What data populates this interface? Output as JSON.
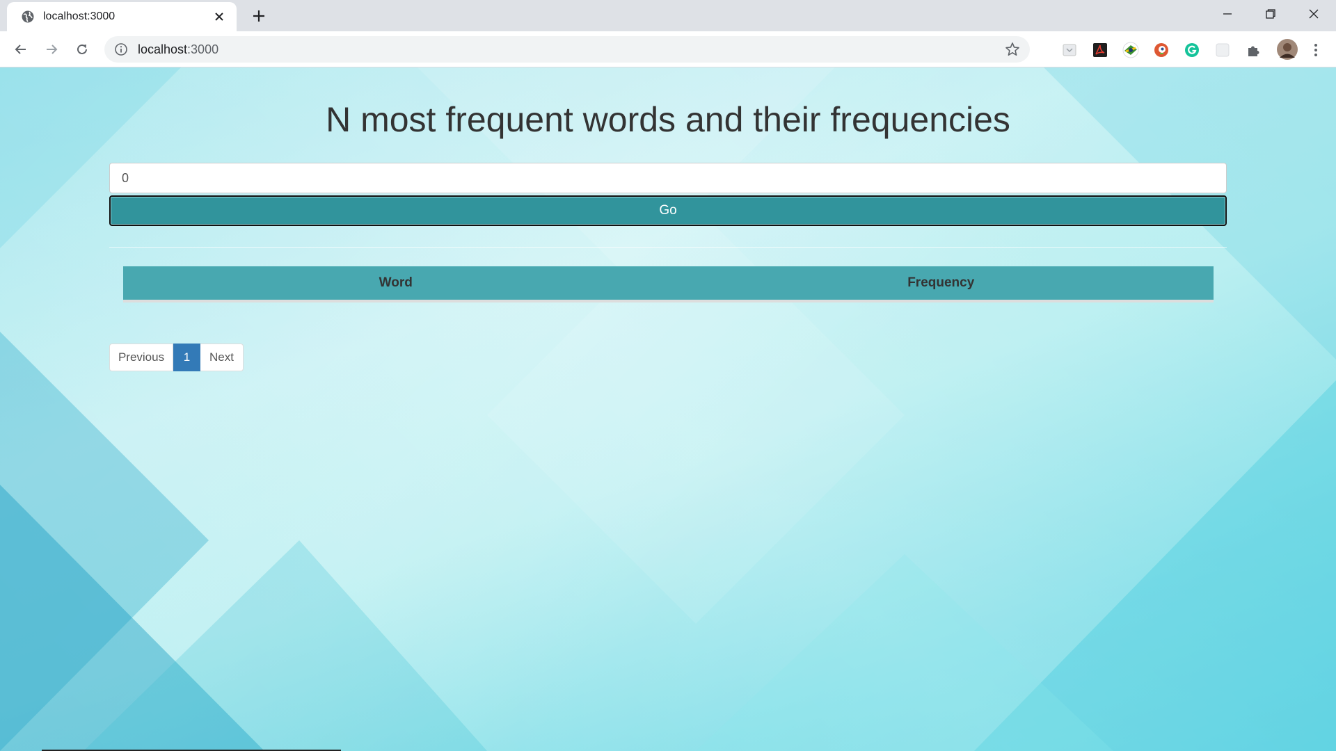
{
  "browser": {
    "tab_title": "localhost:3000",
    "url_host": "localhost",
    "url_rest": ":3000"
  },
  "icons": {
    "favicon": "globe-icon",
    "tab_close": "close-icon",
    "new_tab": "plus-icon",
    "minimize": "minimize-icon",
    "maximize": "restore-icon",
    "close_window": "close-icon",
    "back": "arrow-left-icon",
    "forward": "arrow-right-icon",
    "reload": "reload-icon",
    "site_info": "info-icon",
    "bookmark": "star-icon",
    "extensions": "puzzle-icon"
  },
  "page": {
    "title": "N most frequent words and their frequencies",
    "input_value": "0",
    "go_label": "Go",
    "table": {
      "columns": [
        "Word",
        "Frequency"
      ],
      "rows": []
    },
    "pagination": {
      "previous": "Previous",
      "current": "1",
      "next": "Next"
    }
  },
  "colors": {
    "go_button": "#31949c",
    "table_header": "#48a8b0",
    "page_active": "#337ab7"
  }
}
